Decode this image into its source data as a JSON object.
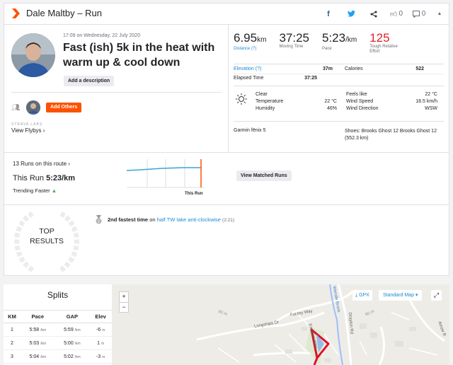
{
  "header": {
    "title": "Dale Maltby – Run",
    "kudos_count": "0",
    "comments_count": "0"
  },
  "activity": {
    "date": "17:09 on Wednesday, 22 July 2020",
    "title": "Fast (ish) 5k in the heat with warm up & cool down",
    "description_button": "Add a description",
    "add_others_button": "Add Others",
    "labs_label": "STRAVA LABS",
    "flyby_link": "View Flybys ›"
  },
  "stats": [
    {
      "value": "6.95",
      "unit": "km",
      "label": "Distance (?)"
    },
    {
      "value": "37:25",
      "unit": "",
      "label": "Moving Time"
    },
    {
      "value": "5:23",
      "unit": "/km",
      "label": "Pace"
    },
    {
      "value": "125",
      "unit": "",
      "label": "Tough Relative Effort"
    }
  ],
  "more_stats": {
    "elevation_label": "Elevation (?)",
    "elevation_value": "37m",
    "calories_label": "Calories",
    "calories_value": "522",
    "elapsed_label": "Elapsed Time",
    "elapsed_value": "37:25"
  },
  "weather": {
    "condition": "Clear",
    "temperature_label": "Temperature",
    "temperature_value": "22 °C",
    "humidity_label": "Humidity",
    "humidity_value": "46%",
    "feels_like_label": "Feels like",
    "feels_like_value": "22 °C",
    "wind_speed_label": "Wind Speed",
    "wind_speed_value": "18.5 km/h",
    "wind_direction_label": "Wind Direction",
    "wind_direction_value": "WSW"
  },
  "gear": {
    "device": "Garmin fēnix 5",
    "shoes_line1": "Shoes: Brooks Ghost 12 Brooks Ghost 12",
    "shoes_line2": "(552.3 km)"
  },
  "route": {
    "runs_link": "13 Runs on this route ›",
    "this_run_label": "This Run",
    "this_run_pace": "5:23/km",
    "trend": "Trending Faster",
    "spark_label": "This Run",
    "match_button": "View Matched Runs"
  },
  "results": {
    "badge_line1": "TOP",
    "badge_line2": "RESULTS",
    "achievement_bold": "2nd fastest time",
    "achievement_on": "on",
    "achievement_segment": "half TW lake anti-clockwise",
    "achievement_time": "(2:21)"
  },
  "splits": {
    "title": "Splits",
    "columns": [
      "KM",
      "Pace",
      "GAP",
      "Elev"
    ],
    "rows": [
      {
        "km": "1",
        "pace": "5:58",
        "gap": "5:59",
        "elev": "-6",
        "pace_unit": "/km",
        "gap_unit": "/km",
        "elev_unit": "m"
      },
      {
        "km": "2",
        "pace": "5:03",
        "gap": "5:00",
        "elev": "1",
        "pace_unit": "/km",
        "gap_unit": "/km",
        "elev_unit": "m"
      },
      {
        "km": "3",
        "pace": "5:04",
        "gap": "5:02",
        "elev": "-3",
        "pace_unit": "/km",
        "gap_unit": "/km",
        "elev_unit": "m"
      }
    ]
  },
  "map": {
    "zoom_in": "+",
    "zoom_out": "−",
    "gpx_label": "GPX",
    "style_label": "Standard Map ▾",
    "labels": {
      "furzey_way": "Furzey Way",
      "longships_dr": "Longships Dr",
      "drayton_rd": "Drayton Rd",
      "brook": "Wendle Brook",
      "arrow_r": "Arrow R",
      "emblem_way": "Emblem Way",
      "m80": "80 m",
      "m90": "90 m"
    }
  },
  "colors": {
    "brand": "#fc5200",
    "link": "#1a8ad4",
    "effort": "#e21d27",
    "route": "#e0102a"
  }
}
